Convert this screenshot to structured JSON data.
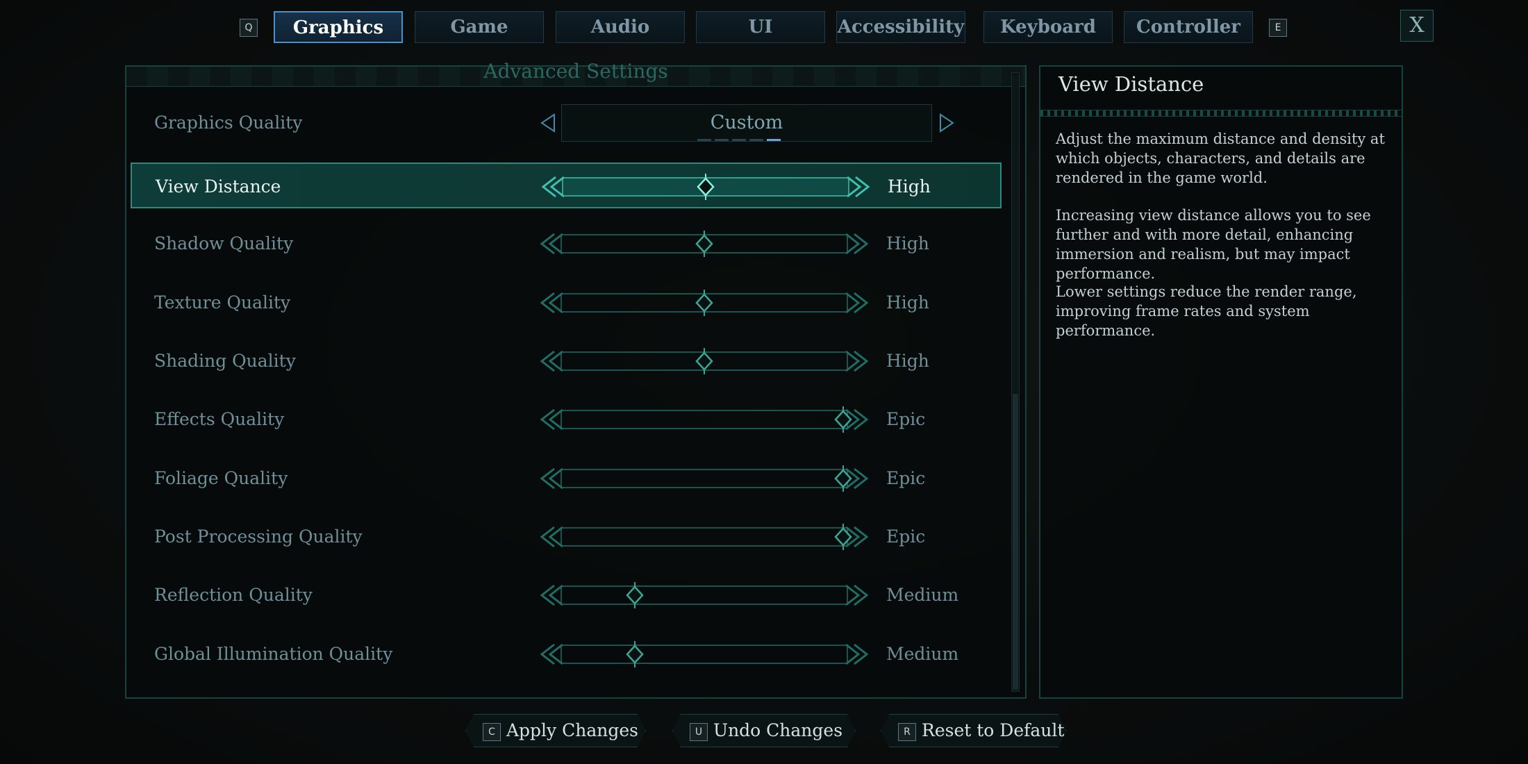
{
  "tabs": {
    "prev_key": "Q",
    "next_key": "E",
    "items": [
      {
        "label": "Graphics",
        "active": true
      },
      {
        "label": "Game",
        "active": false
      },
      {
        "label": "Audio",
        "active": false
      },
      {
        "label": "UI",
        "active": false
      },
      {
        "label": "Accessibility",
        "active": false
      },
      {
        "label": "Keyboard",
        "active": false
      },
      {
        "label": "Controller",
        "active": false
      }
    ],
    "close_label": "X"
  },
  "settings": {
    "section_title": "Advanced Settings",
    "graphics_quality": {
      "label": "Graphics Quality",
      "value": "Custom",
      "preset_count": 5,
      "preset_index": 4
    },
    "rows": [
      {
        "label": "View Distance",
        "value": "High",
        "level": 0.5,
        "selected": true
      },
      {
        "label": "Shadow Quality",
        "value": "High",
        "level": 0.5,
        "selected": false
      },
      {
        "label": "Texture Quality",
        "value": "High",
        "level": 0.5,
        "selected": false
      },
      {
        "label": "Shading Quality",
        "value": "High",
        "level": 0.5,
        "selected": false
      },
      {
        "label": "Effects Quality",
        "value": "Epic",
        "level": 1.0,
        "selected": false
      },
      {
        "label": "Foliage Quality",
        "value": "Epic",
        "level": 1.0,
        "selected": false
      },
      {
        "label": "Post Processing Quality",
        "value": "Epic",
        "level": 1.0,
        "selected": false
      },
      {
        "label": "Reflection Quality",
        "value": "Medium",
        "level": 0.25,
        "selected": false
      },
      {
        "label": "Global Illumination Quality",
        "value": "Medium",
        "level": 0.25,
        "selected": false
      }
    ]
  },
  "description": {
    "title": "View Distance",
    "paragraphs": [
      "Adjust the maximum distance and density at which objects, characters, and details are rendered in the game world.",
      "Increasing view distance allows you to see further and with more detail, enhancing immersion and realism, but may impact performance.",
      "Lower settings reduce the render range, improving frame rates and system performance."
    ]
  },
  "footer": {
    "apply": {
      "key": "C",
      "label": "Apply Changes"
    },
    "undo": {
      "key": "U",
      "label": "Undo Changes"
    },
    "reset": {
      "key": "R",
      "label": "Reset to Default"
    }
  },
  "colors": {
    "accent": "#2e8a7d",
    "active_tab": "#4e8fc7"
  }
}
